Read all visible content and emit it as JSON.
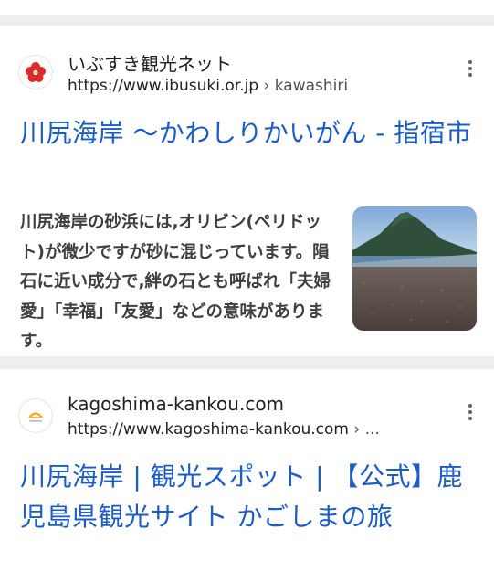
{
  "results": [
    {
      "site_name": "いぶすき観光ネット",
      "url": "https://www.ibusuki.or.jp",
      "breadcrumb": " › kawashiri",
      "title": "川尻海岸 〜かわしりかいがん - 指宿市",
      "snippet": "川尻海岸の砂浜には,オリビン(ペリドット)が微少ですが砂に混じっています。隕石に近い成分で,絆の石とも呼ばれ「夫婦愛」「幸福」「友愛」などの意味があります。",
      "favicon_icon": "red-flower-logo-icon",
      "thumbnail": "beach-with-mountain-photo"
    },
    {
      "site_name": "kagoshima-kankou.com",
      "url": "https://www.kagoshima-kankou.com",
      "breadcrumb": " › ...",
      "title": "川尻海岸 | 観光スポット | 【公式】鹿児島県観光サイト かごしまの旅",
      "favicon_icon": "kagoshima-sun-logo-icon"
    }
  ],
  "colors": {
    "title_link": "#1a5cc8",
    "page_background": "#eceef0",
    "card_background": "#ffffff"
  }
}
